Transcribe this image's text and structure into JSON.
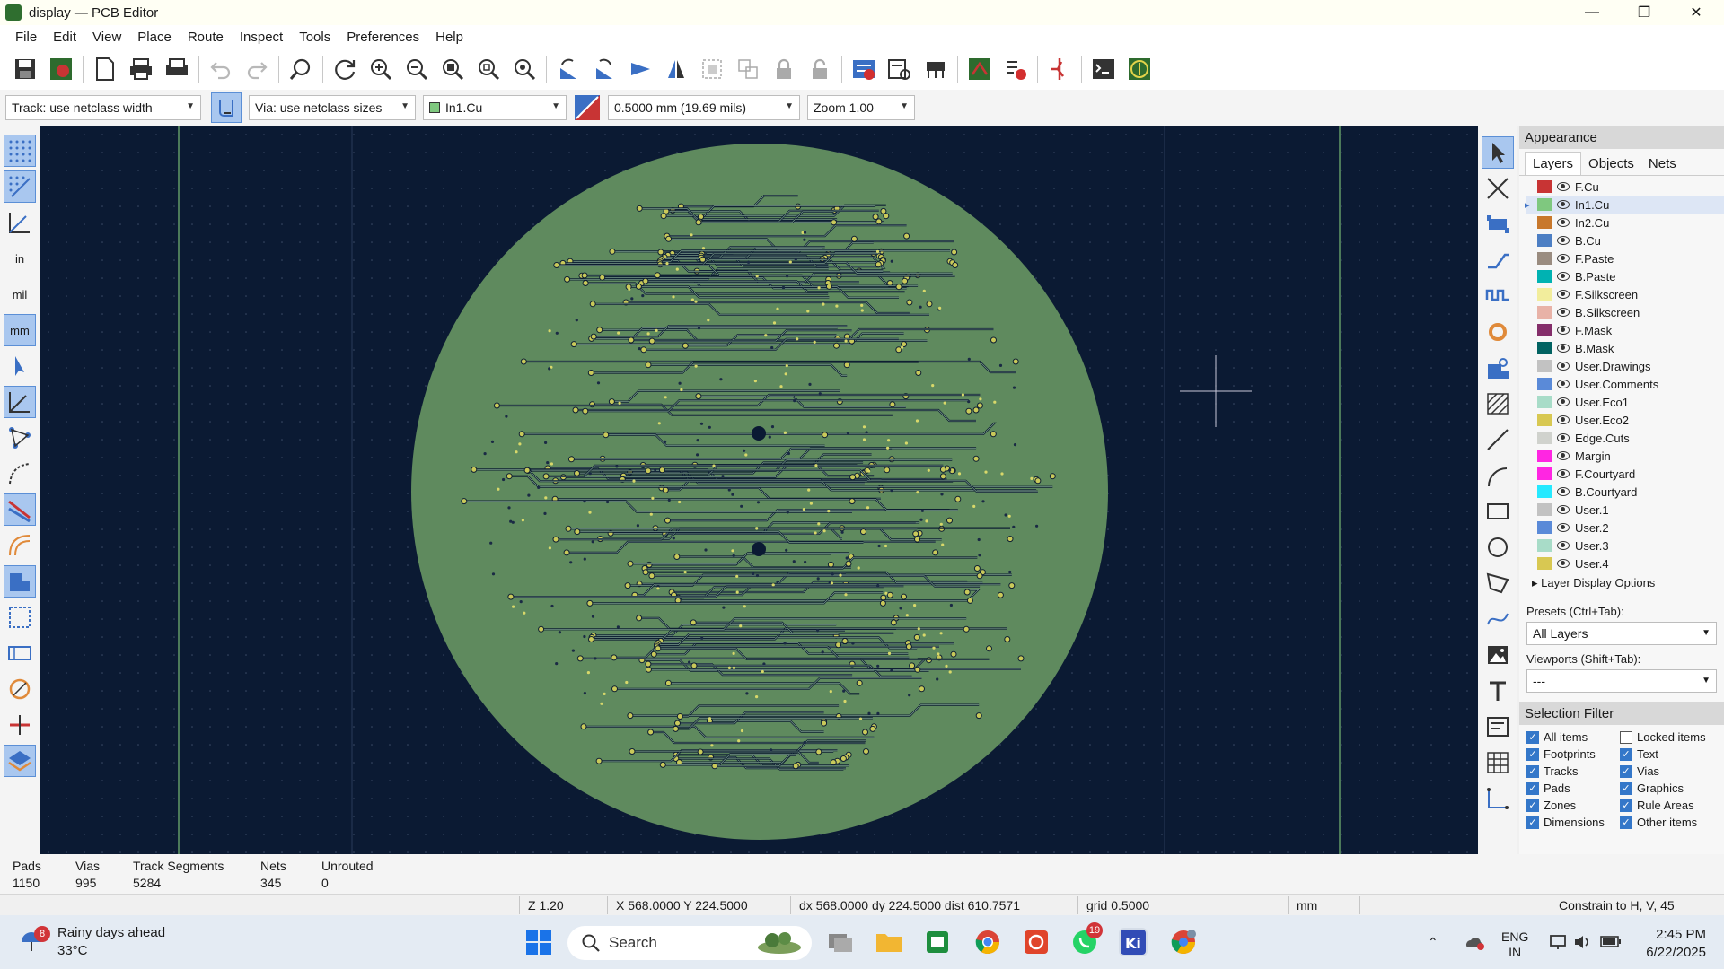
{
  "window": {
    "title": "display — PCB Editor",
    "minimize": "—",
    "maximize": "❐",
    "close": "✕"
  },
  "menu": [
    "File",
    "Edit",
    "View",
    "Place",
    "Route",
    "Inspect",
    "Tools",
    "Preferences",
    "Help"
  ],
  "aux": {
    "track_width": "Track: use netclass width",
    "via_size": "Via: use netclass sizes",
    "layer": "In1.Cu",
    "grid": "0.5000 mm (19.69 mils)",
    "zoom": "Zoom 1.00"
  },
  "left_toolbar": {
    "in_label": "in",
    "mil_label": "mil",
    "mm_label": "mm"
  },
  "appearance": {
    "title": "Appearance",
    "tabs": [
      "Layers",
      "Objects",
      "Nets"
    ],
    "layers": [
      {
        "name": "F.Cu",
        "color": "#c83434"
      },
      {
        "name": "In1.Cu",
        "color": "#7fc87f"
      },
      {
        "name": "In2.Cu",
        "color": "#c8782c"
      },
      {
        "name": "B.Cu",
        "color": "#4d7fc4"
      },
      {
        "name": "F.Paste",
        "color": "#9a8c80"
      },
      {
        "name": "B.Paste",
        "color": "#00b2b2"
      },
      {
        "name": "F.Silkscreen",
        "color": "#f2ed9c"
      },
      {
        "name": "B.Silkscreen",
        "color": "#e8b2a7"
      },
      {
        "name": "F.Mask",
        "color": "#842e6a"
      },
      {
        "name": "B.Mask",
        "color": "#026362"
      },
      {
        "name": "User.Drawings",
        "color": "#c2c2c2"
      },
      {
        "name": "User.Comments",
        "color": "#5a8ad8"
      },
      {
        "name": "User.Eco1",
        "color": "#a8dcc8"
      },
      {
        "name": "User.Eco2",
        "color": "#d8c852"
      },
      {
        "name": "Edge.Cuts",
        "color": "#d0d2cd"
      },
      {
        "name": "Margin",
        "color": "#ff26e2"
      },
      {
        "name": "F.Courtyard",
        "color": "#ff26e2"
      },
      {
        "name": "B.Courtyard",
        "color": "#26e9ff"
      },
      {
        "name": "User.1",
        "color": "#c2c2c2"
      },
      {
        "name": "User.2",
        "color": "#5a8ad8"
      },
      {
        "name": "User.3",
        "color": "#a8dcc8"
      },
      {
        "name": "User.4",
        "color": "#d8c852"
      }
    ],
    "layer_display_options": "Layer Display Options",
    "presets_label": "Presets (Ctrl+Tab):",
    "presets_value": "All Layers",
    "viewports_label": "Viewports (Shift+Tab):",
    "viewports_value": "---"
  },
  "selection_filter": {
    "title": "Selection Filter",
    "items": [
      {
        "label": "All items",
        "checked": true
      },
      {
        "label": "Locked items",
        "checked": false
      },
      {
        "label": "Footprints",
        "checked": true
      },
      {
        "label": "Text",
        "checked": true
      },
      {
        "label": "Tracks",
        "checked": true
      },
      {
        "label": "Vias",
        "checked": true
      },
      {
        "label": "Pads",
        "checked": true
      },
      {
        "label": "Graphics",
        "checked": true
      },
      {
        "label": "Zones",
        "checked": true
      },
      {
        "label": "Rule Areas",
        "checked": true
      },
      {
        "label": "Dimensions",
        "checked": true
      },
      {
        "label": "Other items",
        "checked": true
      }
    ]
  },
  "stats": {
    "pads_label": "Pads",
    "pads": "1150",
    "vias_label": "Vias",
    "vias": "995",
    "tracks_label": "Track Segments",
    "tracks": "5284",
    "nets_label": "Nets",
    "nets": "345",
    "unrouted_label": "Unrouted",
    "unrouted": "0"
  },
  "status": {
    "zoom": "Z 1.20",
    "xy": "X 568.0000  Y 224.5000",
    "delta": "dx 568.0000  dy 224.5000  dist 610.7571",
    "grid": "grid 0.5000",
    "units": "mm",
    "constrain": "Constrain to H, V, 45"
  },
  "taskbar": {
    "weather_title": "Rainy days ahead",
    "weather_temp": "33°C",
    "weather_badge": "8",
    "search": "Search",
    "whatsapp_badge": "19",
    "lang1": "ENG",
    "lang2": "IN",
    "time": "2:45 PM",
    "date": "6/22/2025"
  }
}
